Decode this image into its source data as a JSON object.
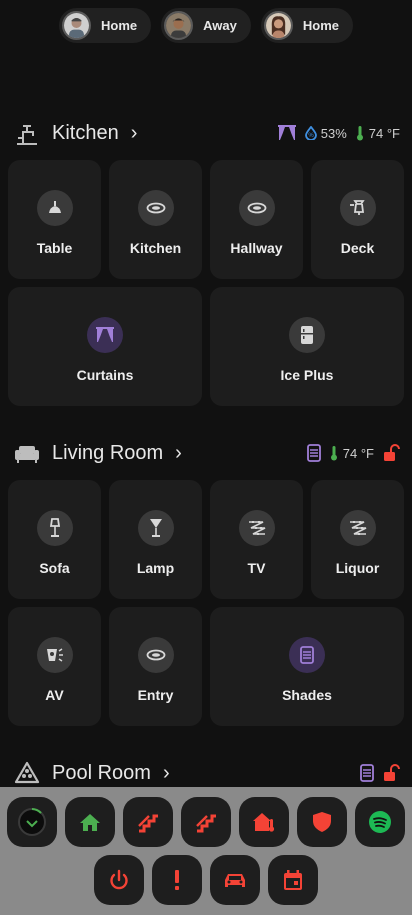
{
  "presence": [
    {
      "name_hidden": "",
      "status": "Home",
      "avatar": "person-1"
    },
    {
      "name_hidden": "",
      "status": "Away",
      "avatar": "person-2"
    },
    {
      "name_hidden": "",
      "status": "Home",
      "avatar": "person-3"
    }
  ],
  "kitchen": {
    "title": "Kitchen",
    "icon": "faucet-icon",
    "chips": {
      "humidity": "53%",
      "temperature": "74 °F"
    },
    "tiles": [
      {
        "label": "Table",
        "icon": "ceiling-light-icon"
      },
      {
        "label": "Kitchen",
        "icon": "recessed-light-icon"
      },
      {
        "label": "Hallway",
        "icon": "recessed-light-icon"
      },
      {
        "label": "Deck",
        "icon": "outdoor-lantern-icon"
      },
      {
        "label": "Curtains",
        "icon": "curtains-icon"
      },
      {
        "label": "Ice Plus",
        "icon": "fridge-icon"
      }
    ]
  },
  "living": {
    "title": "Living Room",
    "icon": "sofa-icon",
    "chips": {
      "temperature": "74 °F"
    },
    "tiles": [
      {
        "label": "Sofa",
        "icon": "floor-lamp-icon"
      },
      {
        "label": "Lamp",
        "icon": "cocktail-glass-icon"
      },
      {
        "label": "TV",
        "icon": "led-strip-icon"
      },
      {
        "label": "Liquor",
        "icon": "led-strip-icon"
      },
      {
        "label": "AV",
        "icon": "speaker-icon"
      },
      {
        "label": "Entry",
        "icon": "recessed-light-icon"
      },
      {
        "label": "Shades",
        "icon": "blinds-icon"
      }
    ]
  },
  "pool": {
    "title": "Pool Room",
    "icon": "billiards-rack-icon"
  },
  "chevron": "›",
  "dock": {
    "row1": [
      "scroll-indicator-icon",
      "home-icon",
      "stairs-icon",
      "stairs-icon",
      "home-thermometer-icon",
      "shield-icon",
      "spotify-icon"
    ],
    "row2": [
      "power-icon",
      "alert-icon",
      "car-icon",
      "calendar-icon"
    ]
  },
  "colors": {
    "accent_purple": "#a07fd8",
    "humidity_blue": "#3f8fe0",
    "temp_green": "#4caf50",
    "lock_red": "#f44336",
    "home_green": "#4caf50",
    "action_red": "#f44336",
    "spotify_green": "#1db954"
  }
}
